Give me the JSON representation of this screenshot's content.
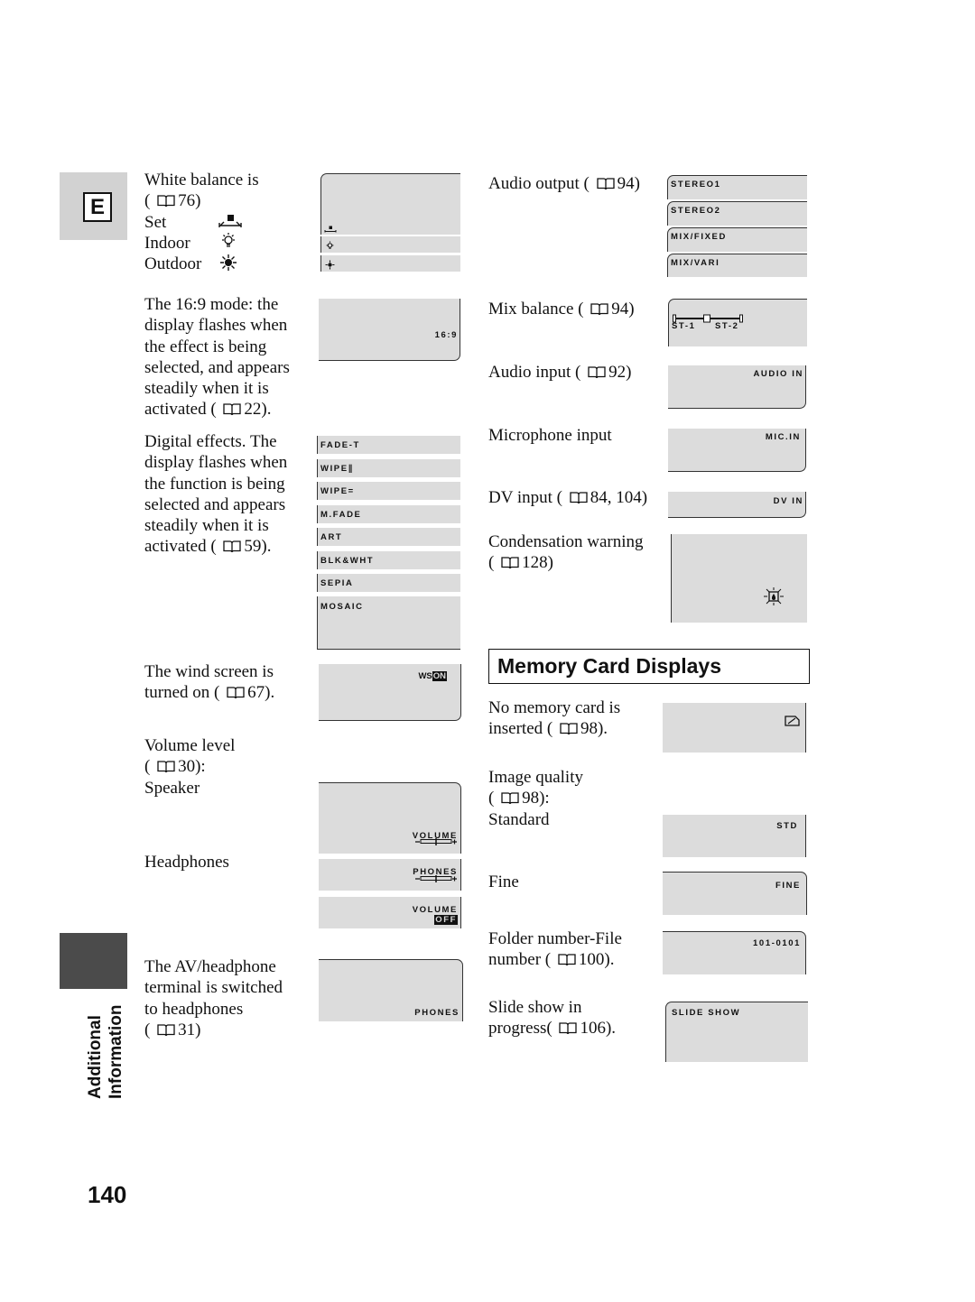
{
  "section_letter": "E",
  "side_label": [
    "Additional",
    "Information"
  ],
  "page_number": "140",
  "memory_card_heading": "Memory Card Displays",
  "left_texts": {
    "white_balance": [
      [
        "White balance is"
      ],
      [
        "( ",
        "76)"
      ],
      [
        "Set"
      ],
      [
        "Indoor"
      ],
      [
        "Outdoor"
      ]
    ],
    "mode_169": [
      [
        "The 16:9 mode: the"
      ],
      [
        "display flashes when"
      ],
      [
        "the effect is being"
      ],
      [
        "selected, and appears"
      ],
      [
        "steadily when it is"
      ],
      [
        "activated ( ",
        "22)."
      ]
    ],
    "digital_effects": [
      [
        "Digital effects. The"
      ],
      [
        "display flashes when"
      ],
      [
        "the function is being"
      ],
      [
        "selected and appears"
      ],
      [
        "steadily when it is"
      ],
      [
        "activated ( ",
        "59)."
      ]
    ],
    "wind_screen": [
      [
        "The wind screen is"
      ],
      [
        "turned on ( ",
        "67)."
      ]
    ],
    "volume": [
      [
        "Volume level"
      ],
      [
        "( ",
        "30):"
      ],
      [
        "Speaker"
      ]
    ],
    "headphones": [
      [
        "Headphones"
      ]
    ],
    "av_terminal": [
      [
        "The AV/headphone"
      ],
      [
        "terminal is switched"
      ],
      [
        "to headphones"
      ],
      [
        "( ",
        "31)"
      ]
    ]
  },
  "right_texts": {
    "audio_output": [
      [
        "Audio output ( ",
        "94)"
      ]
    ],
    "mix_balance": [
      [
        "Mix balance ( ",
        "94)"
      ]
    ],
    "audio_input": [
      [
        "Audio input ( ",
        "92)"
      ]
    ],
    "mic_input": [
      [
        "Microphone input"
      ]
    ],
    "dv_input": [
      [
        "DV input ( ",
        "84, 104)"
      ]
    ],
    "condensation": [
      [
        "Condensation warning"
      ],
      [
        "( ",
        "128)"
      ]
    ],
    "no_card": [
      [
        "No memory card is"
      ],
      [
        "inserted ( ",
        "98)."
      ]
    ],
    "image_quality": [
      [
        "Image quality"
      ],
      [
        "( ",
        "98):"
      ],
      [
        "Standard"
      ]
    ],
    "fine": [
      [
        "Fine"
      ]
    ],
    "folder_file": [
      [
        "Folder number-File"
      ],
      [
        "number ( ",
        "100)."
      ]
    ],
    "slide_show": [
      [
        "Slide show in"
      ],
      [
        "progress( ",
        "106)."
      ]
    ]
  },
  "displays": {
    "mode_169": "16:9",
    "digital_effects": [
      "FADE-T",
      "WIPE∥",
      "WIPE=",
      "M.FADE",
      "ART",
      "BLK&WHT",
      "SEPIA",
      "MOSAIC"
    ],
    "wind_screen": {
      "prefix": "WS",
      "state": "ON"
    },
    "volume_speaker": "VOLUME",
    "volume_phones": "PHONES",
    "volume_off": {
      "label": "VOLUME",
      "state": "OFF"
    },
    "av_phones": "PHONES",
    "audio_output": [
      "STEREO1",
      "STEREO2",
      "MIX/FIXED",
      "MIX/VARI"
    ],
    "mix_balance": {
      "left": "ST-1",
      "right": "ST-2",
      "position": 0.5
    },
    "audio_input": "AUDIO IN",
    "mic_input": "MIC.IN",
    "dv_input": "DV IN",
    "quality_standard": "STD",
    "quality_fine": "FINE",
    "folder_file": "101-0101",
    "slide_show": "SLIDE SHOW"
  },
  "icons": {
    "wb_set": "white-balance-set-icon",
    "wb_indoor": "indoor-bulb-icon",
    "wb_outdoor": "outdoor-sun-icon",
    "book": "book-reference-icon",
    "condensation": "condensation-warning-icon",
    "no_card": "memory-card-icon"
  },
  "colors": {
    "panel": "#dcdcdc",
    "text": "#111111",
    "side_block": "#4b4b4b",
    "tab_block": "#d2d2d2"
  }
}
